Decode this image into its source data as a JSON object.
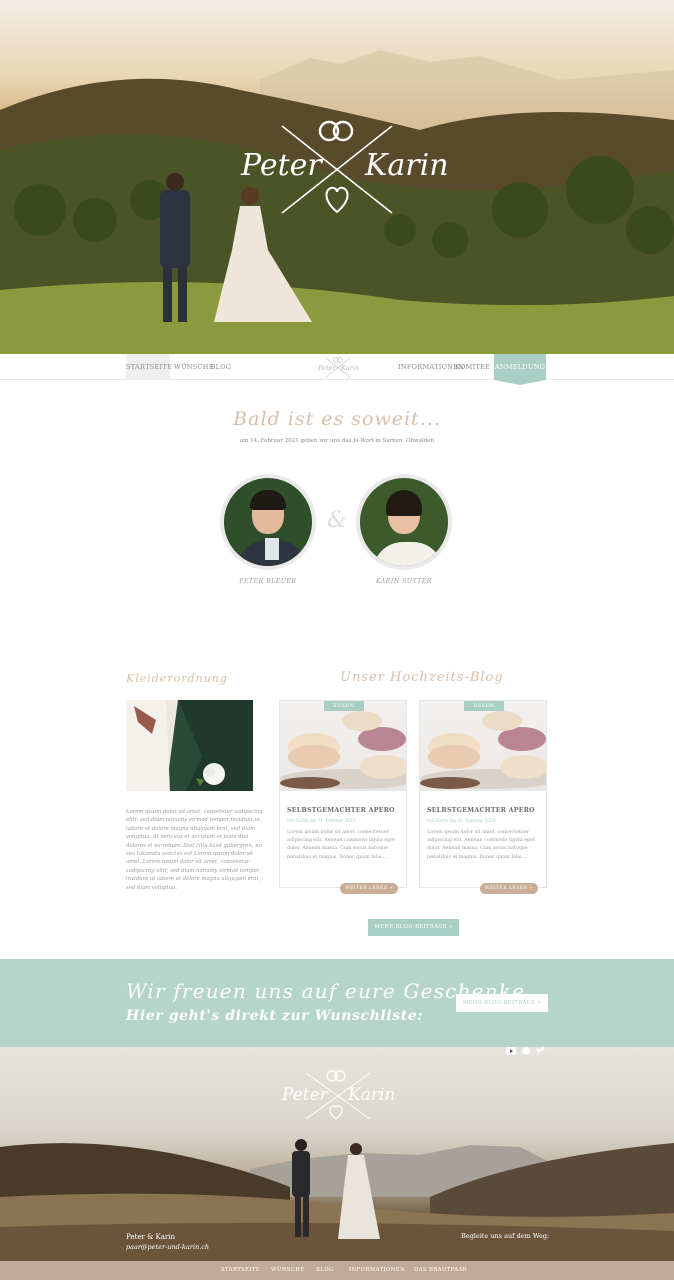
{
  "hero": {
    "logo": {
      "left": "Peter",
      "right": "Karin"
    }
  },
  "nav": {
    "items": [
      "STARTSEITE",
      "WÜNSCHE",
      "BLOG",
      "INFORMATIONEN",
      "KOMITEE"
    ],
    "cta": "ANMELDUNG",
    "mini_logo": {
      "left": "Peter",
      "right": "Karin"
    }
  },
  "intro": {
    "title": "Bald ist es soweit...",
    "date_line": "am 14. Februar 2021 geben wir uns das Ja-Wort in Sarnen, Obwalden",
    "groom": "PETER BLEUER",
    "bride": "KARIN SUTTER",
    "amp": "&"
  },
  "dresscode": {
    "title": "Kleiderordnung",
    "text": "Lorem ipsum dolor sit amet, consetetur sadipscing elitr, sed diam nonumy eirmod tempor invidunt ut labore et dolore magna aliquyam erat, sed diam voluptua. At vero eos et accusam et justo duo dolores et ea rebum. Stet clita kasd gubergren, no sea takimata sanctus est Lorem ipsum dolor sit amet. Lorem ipsum dolor sit amet, consetetur sadipscing elitr, sed diam nonumy eirmod tempor invidunt ut labore et dolore magna aliquyam erat, sed diam voluptua."
  },
  "blog": {
    "title": "Unser Hochzeits-Blog",
    "posts": [
      {
        "badge": "ESSEN",
        "title": "SELBSTGEMACHTER APERO",
        "meta": "von Karin am 31. Februar 2020",
        "excerpt": "Lorem ipsum dolor sit amet, consectetuer adipiscing elit. Aenean commodo ligula eget dolor. Aenean massa. Cum sociis natoque penatibus et magnis. Donec quam felis,...",
        "more": "WEITER LESEN »"
      },
      {
        "badge": "ESSEN",
        "title": "SELBSTGEMACHTER APERO",
        "meta": "von Karin am 31. Februar 2020",
        "excerpt": "Lorem ipsum dolor sit amet, consectetuer adipiscing elit. Aenean commodo ligula eget dolor. Aenean massa. Cum sociis natoque penatibus et magnis. Donec quam felis,...",
        "more": "WEITER LESEN »"
      }
    ],
    "more_button": "MEHR BLOG-BEITRÄGE »"
  },
  "gift": {
    "line1": "Wir freuen uns auf eure Geschenke.",
    "line2": "Hier geht's direkt zur Wunschliste:",
    "button": "MEHR BLOG-BEITRÄGE »"
  },
  "footer": {
    "logo": {
      "left": "Peter",
      "right": "Karin"
    },
    "names": "Peter & Karin",
    "email": "paar@peter-und-karin.ch",
    "follow": "Begleite uns auf dem Weg:",
    "socials": [
      "youtube-icon",
      "snapchat-icon",
      "twitter-icon"
    ],
    "nav": [
      "STARTSEITE",
      "WÜNSCHE",
      "BLOG",
      "INFORMATIONEN",
      "DAS BRAUTPAAR"
    ]
  },
  "colors": {
    "mint": "#a9cfc4",
    "sand": "#c2ab96",
    "script": "#d9bfa8"
  }
}
